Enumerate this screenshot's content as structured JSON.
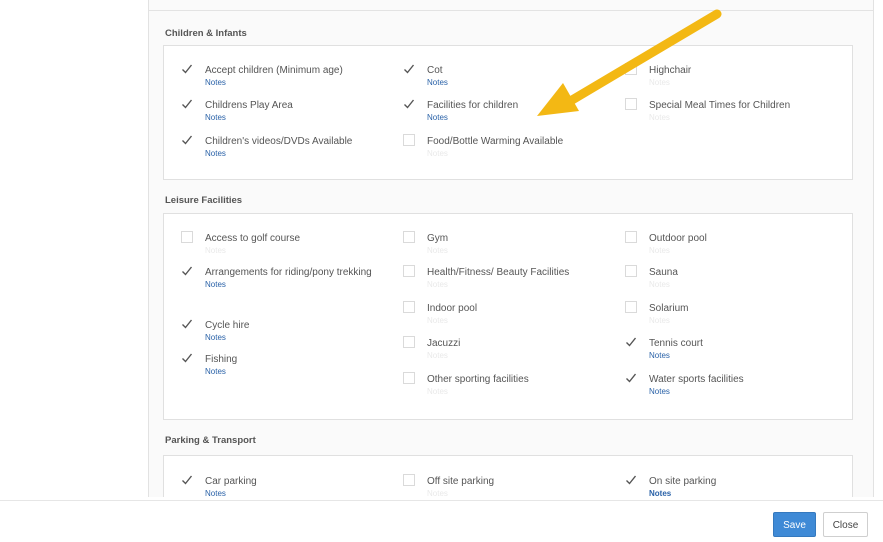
{
  "sections": [
    {
      "title": "Children & Infants",
      "items": [
        {
          "label": "Accept children (Minimum age)",
          "checked": true,
          "notes": "Notes"
        },
        {
          "label": "Cot",
          "checked": true,
          "notes": "Notes"
        },
        {
          "label": "Highchair",
          "checked": false,
          "notes": "Notes"
        },
        {
          "label": "Childrens Play Area",
          "checked": true,
          "notes": "Notes"
        },
        {
          "label": "Facilities for children",
          "checked": true,
          "notes": "Notes"
        },
        {
          "label": "Special Meal Times for Children",
          "checked": false,
          "notes": "Notes"
        },
        {
          "label": "Children's videos/DVDs Available",
          "checked": true,
          "notes": "Notes"
        },
        {
          "label": "Food/Bottle Warming Available",
          "checked": false,
          "notes": "Notes"
        }
      ]
    },
    {
      "title": "Leisure Facilities",
      "items": [
        {
          "label": "Access to golf course",
          "checked": false,
          "notes": "Notes"
        },
        {
          "label": "Gym",
          "checked": false,
          "notes": "Notes"
        },
        {
          "label": "Outdoor pool",
          "checked": false,
          "notes": "Notes"
        },
        {
          "label": "Arrangements for riding/pony trekking",
          "checked": true,
          "notes": "Notes"
        },
        {
          "label": "Health/Fitness/ Beauty Facilities",
          "checked": false,
          "notes": "Notes"
        },
        {
          "label": "Sauna",
          "checked": false,
          "notes": "Notes"
        },
        {
          "label": "Indoor pool",
          "checked": false,
          "notes": "Notes"
        },
        {
          "label": "Solarium",
          "checked": false,
          "notes": "Notes"
        },
        {
          "label": "Cycle hire",
          "checked": true,
          "notes": "Notes"
        },
        {
          "label": "Jacuzzi",
          "checked": false,
          "notes": "Notes"
        },
        {
          "label": "Tennis court",
          "checked": true,
          "notes": "Notes"
        },
        {
          "label": "Fishing",
          "checked": true,
          "notes": "Notes"
        },
        {
          "label": "Other sporting facilities",
          "checked": false,
          "notes": "Notes"
        },
        {
          "label": "Water sports facilities",
          "checked": true,
          "notes": "Notes"
        }
      ]
    },
    {
      "title": "Parking & Transport",
      "items": [
        {
          "label": "Car parking",
          "checked": true,
          "notes": "Notes"
        },
        {
          "label": "Off site parking",
          "checked": false,
          "notes": "Notes"
        },
        {
          "label": "On site parking",
          "checked": true,
          "notes": "Notes"
        }
      ]
    }
  ],
  "footer": {
    "save_label": "Save",
    "close_label": "Close"
  },
  "colors": {
    "accent": "#3f8ad6",
    "notes_link": "#2a62a8",
    "arrow": "#f3b814"
  }
}
